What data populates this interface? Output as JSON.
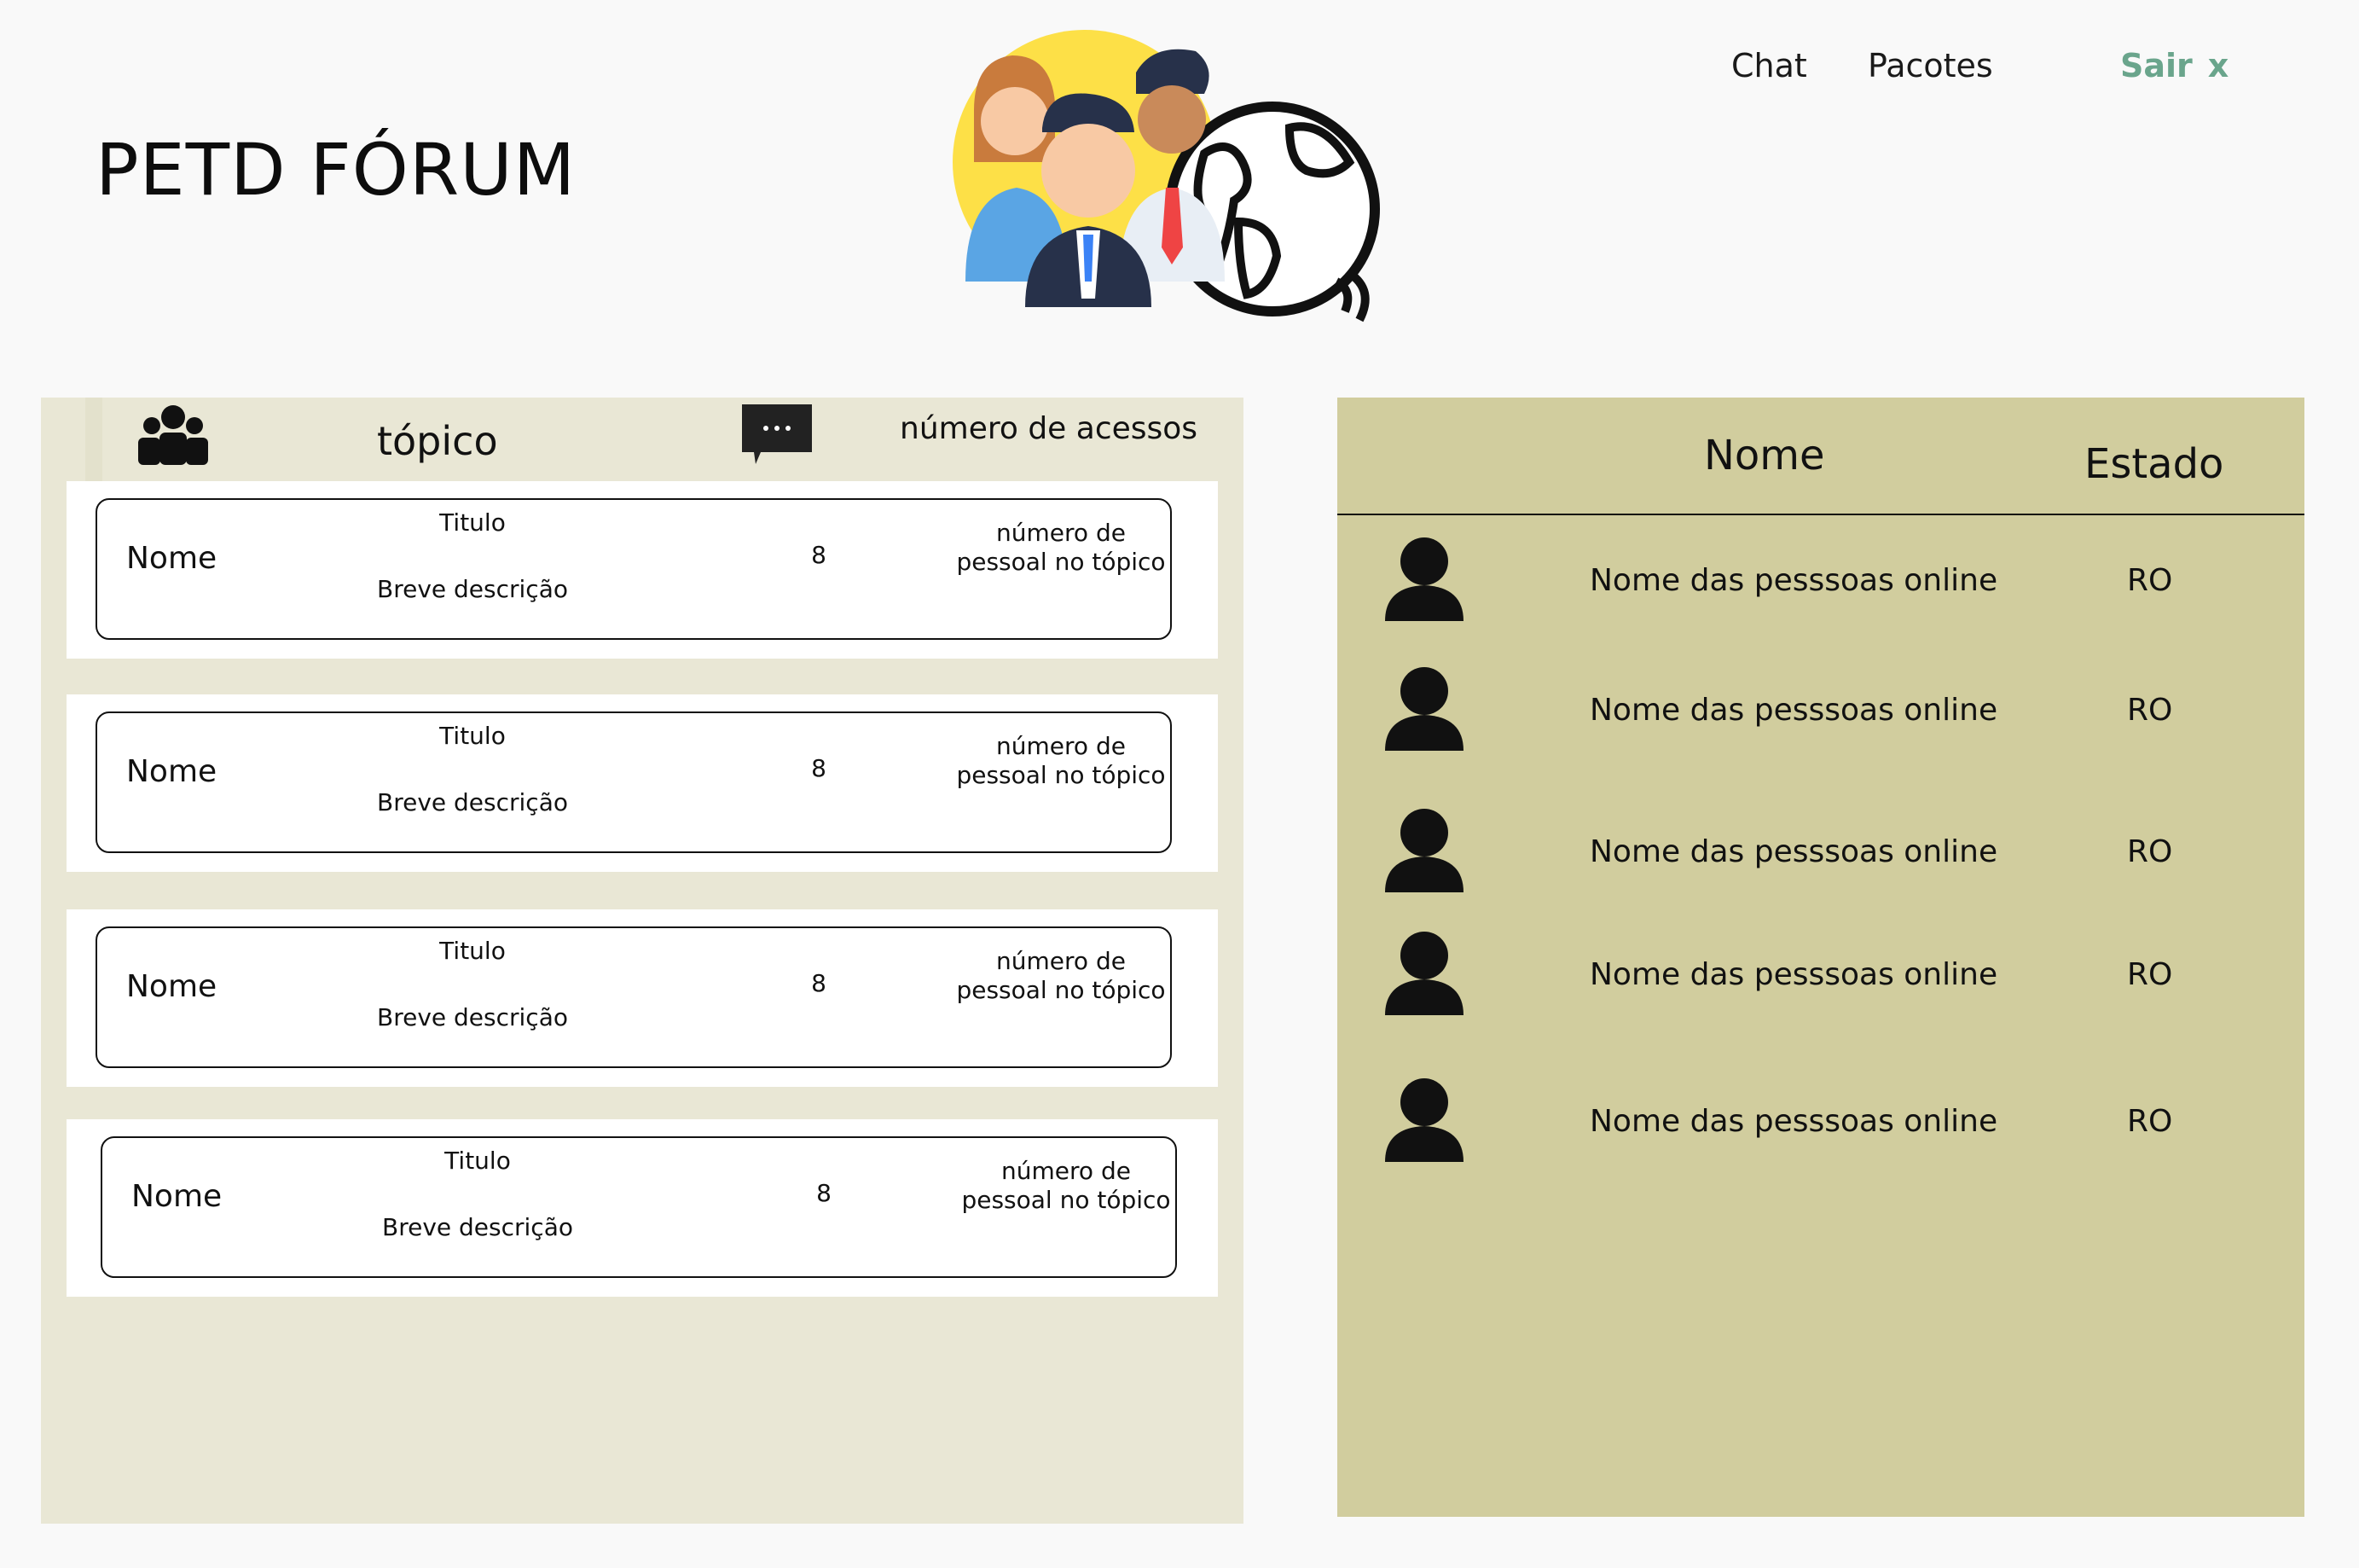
{
  "header": {
    "title": "PETD FÓRUM",
    "nav": {
      "chat": "Chat",
      "packages": "Pacotes",
      "logout": "Sair",
      "logout_x": "x"
    },
    "colors": {
      "logout": "#6aa58c"
    }
  },
  "topics": {
    "header": {
      "topic_label": "tópico",
      "views_label": "número de acessos",
      "icons": [
        "people-group-icon",
        "chat-bubble-icon"
      ]
    },
    "items": [
      {
        "name": "Nome",
        "title": "Titulo",
        "description": "Breve descrição",
        "count": "8",
        "people_line1": "número de",
        "people_line2": "pessoal no tópico"
      },
      {
        "name": "Nome",
        "title": "Titulo",
        "description": "Breve descrição",
        "count": "8",
        "people_line1": "número de",
        "people_line2": "pessoal no tópico"
      },
      {
        "name": "Nome",
        "title": "Titulo",
        "description": "Breve descrição",
        "count": "8",
        "people_line1": "número de",
        "people_line2": "pessoal no tópico"
      },
      {
        "name": "Nome",
        "title": "Titulo",
        "description": "Breve descrição",
        "count": "8",
        "people_line1": "número de",
        "people_line2": "pessoal no tópico"
      }
    ]
  },
  "online": {
    "header": {
      "name": "Nome",
      "state": "Estado"
    },
    "users": [
      {
        "name": "Nome das pesssoas online",
        "state": "RO"
      },
      {
        "name": "Nome das pesssoas online",
        "state": "RO"
      },
      {
        "name": "Nome das pesssoas online",
        "state": "RO"
      },
      {
        "name": "Nome das pesssoas online",
        "state": "RO"
      },
      {
        "name": "Nome das pesssoas online",
        "state": "RO"
      }
    ]
  }
}
